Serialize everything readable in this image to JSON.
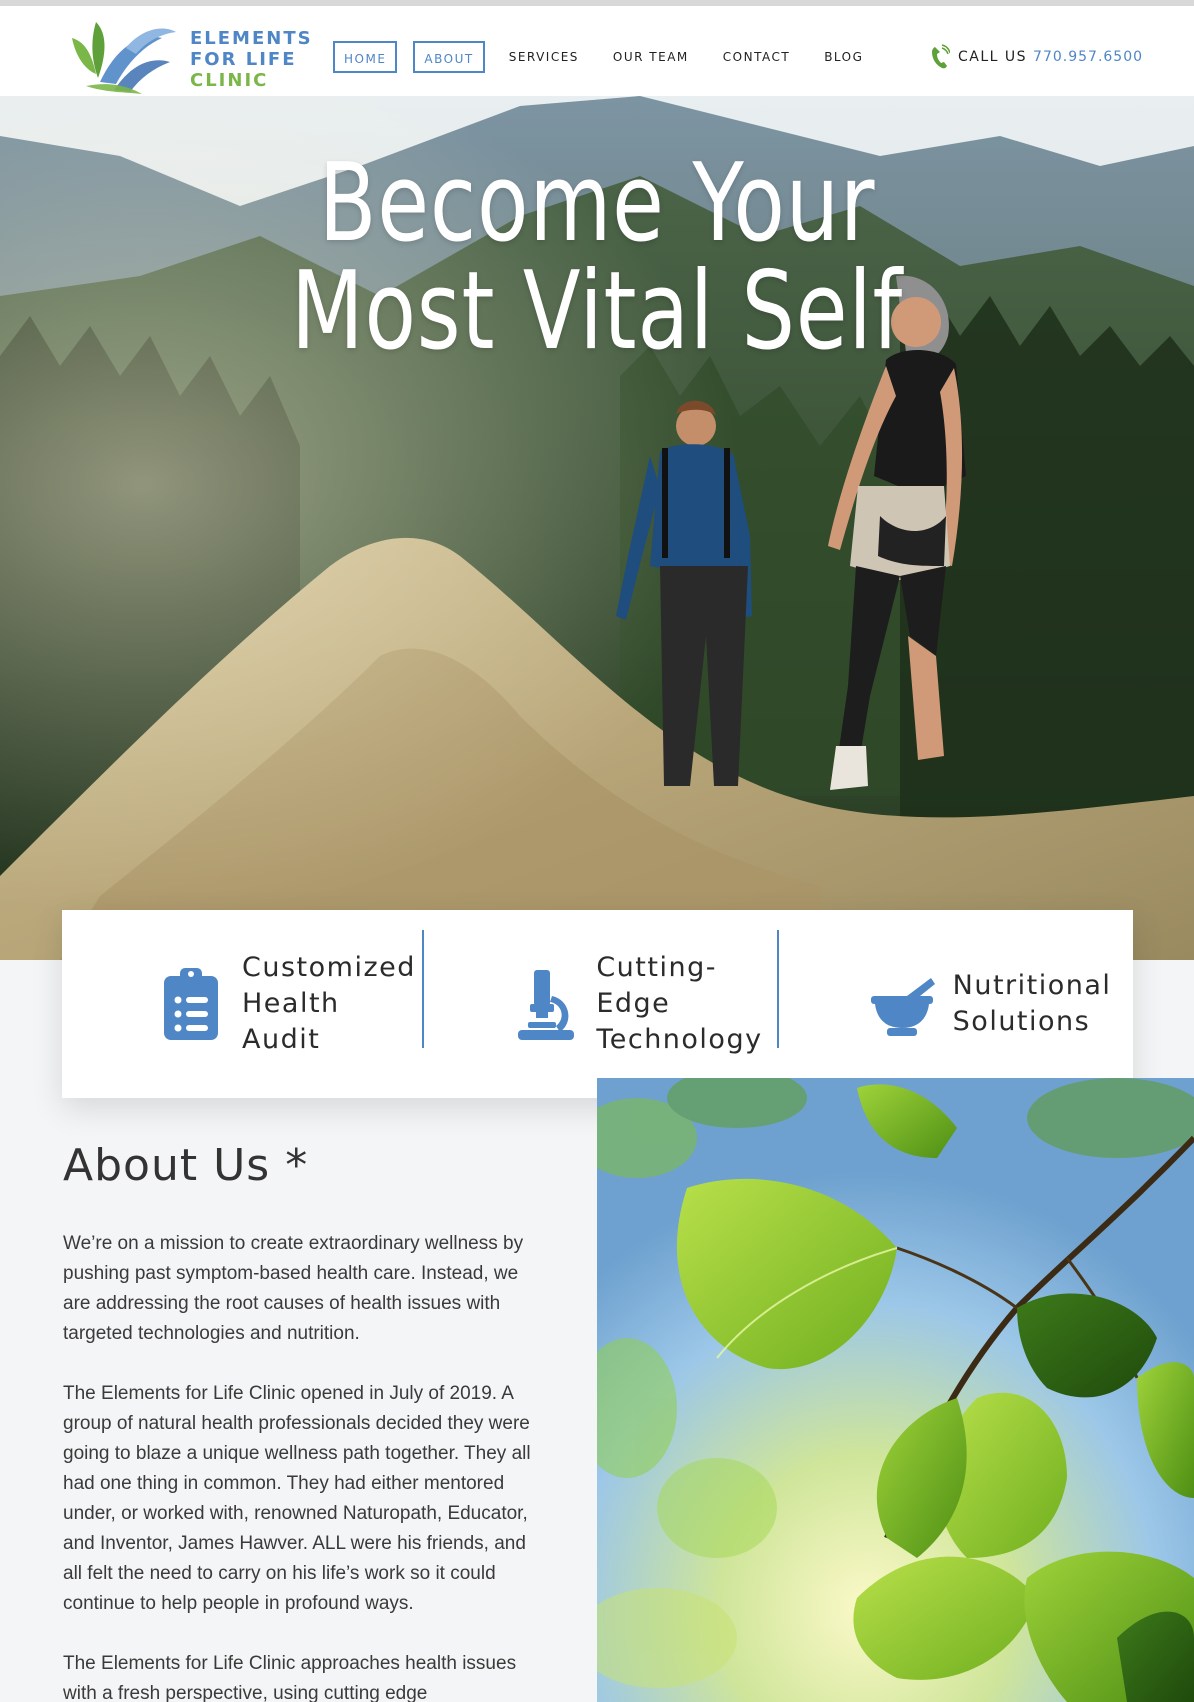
{
  "brand": {
    "line1": "ELEMENTS",
    "line2": "FOR LIFE",
    "line3": "CLINIC"
  },
  "nav": {
    "items": [
      {
        "label": "HOME",
        "boxed": true
      },
      {
        "label": "ABOUT",
        "boxed": true
      },
      {
        "label": "SERVICES",
        "boxed": false
      },
      {
        "label": "OUR TEAM",
        "boxed": false
      },
      {
        "label": "CONTACT",
        "boxed": false
      },
      {
        "label": "BLOG",
        "boxed": false
      }
    ]
  },
  "call": {
    "label": "CALL US",
    "number": "770.957.6500",
    "icon": "phone-icon"
  },
  "hero": {
    "title_line1": "Become Your",
    "title_line2": "Most Vital Self"
  },
  "features": [
    {
      "label": "Customized\nHealth Audit",
      "icon": "clipboard-list-icon"
    },
    {
      "label": "Cutting-\nEdge\nTechnology",
      "icon": "microscope-icon"
    },
    {
      "label": "Nutritional\nSolutions",
      "icon": "mortar-pestle-icon"
    }
  ],
  "about": {
    "title": "About Us *",
    "paragraphs": [
      "We’re on a mission to create extraordinary wellness by pushing past symptom-based health care.  Instead, we are addressing the root causes of health issues with targeted technologies and nutrition.",
      "The  Elements for  Life Clinic opened in July of 2019. A group of natural health professionals decided they were going to blaze a unique wellness path together. They all had one thing in common. They had either mentored under, or worked with, renowned  Naturopath,  Educator, and  Inventor, James  Hawver. ALL were his friends, and all felt the need to carry on his life’s work so it could continue to help people in profound ways.",
      "The  Elements for  Life Clinic approaches health issues with a fresh perspective, using cutting edge"
    ]
  },
  "colors": {
    "accent_blue": "#4f86c6",
    "accent_green": "#7ab648"
  }
}
